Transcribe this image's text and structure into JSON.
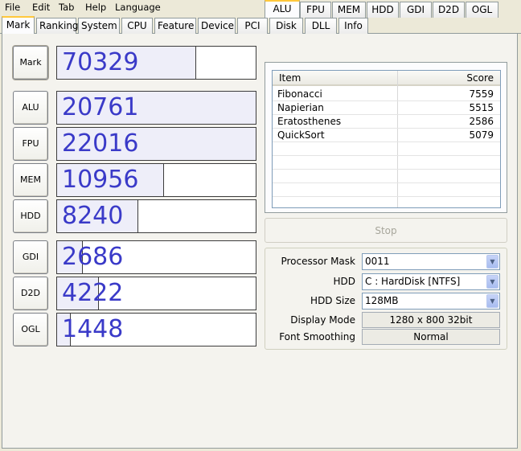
{
  "menu": [
    "File",
    "Edit",
    "Tab",
    "Help",
    "Language"
  ],
  "tabs": [
    "Mark",
    "Ranking",
    "System",
    "CPU",
    "Feature",
    "Device",
    "PCI",
    "Disk",
    "DLL",
    "Info"
  ],
  "active_tab": "Mark",
  "benchmarks": [
    {
      "label": "Mark",
      "score": "70329",
      "fill_fraction": 0.7
    },
    {
      "label": "ALU",
      "score": "20761",
      "fill_fraction": 1.0
    },
    {
      "label": "FPU",
      "score": "22016",
      "fill_fraction": 1.0
    },
    {
      "label": "MEM",
      "score": "10956",
      "fill_fraction": 0.54
    },
    {
      "label": "HDD",
      "score": "8240",
      "fill_fraction": 0.41
    },
    {
      "label": "GDI",
      "score": "2686",
      "fill_fraction": 0.13
    },
    {
      "label": "D2D",
      "score": "4222",
      "fill_fraction": 0.21
    },
    {
      "label": "OGL",
      "score": "1448",
      "fill_fraction": 0.07
    }
  ],
  "sub_tabs": [
    "ALU",
    "FPU",
    "MEM",
    "HDD",
    "GDI",
    "D2D",
    "OGL"
  ],
  "active_sub_tab": "ALU",
  "table": {
    "columns": [
      "Item",
      "Score"
    ],
    "rows": [
      [
        "Fibonacci",
        "7559"
      ],
      [
        "Napierian",
        "5515"
      ],
      [
        "Eratosthenes",
        "2586"
      ],
      [
        "QuickSort",
        "5079"
      ]
    ]
  },
  "stop_label": "Stop",
  "settings": {
    "processor_mask_label": "Processor Mask",
    "processor_mask_value": "0011",
    "hdd_label": "HDD",
    "hdd_value": "C : HardDisk [NTFS]",
    "hdd_size_label": "HDD Size",
    "hdd_size_value": "128MB",
    "display_mode_label": "Display Mode",
    "display_mode_value": "1280 x 800 32bit",
    "font_smoothing_label": "Font Smoothing",
    "font_smoothing_value": "Normal"
  },
  "colors": {
    "score_text": "#3a3ac8",
    "bar_fill": "#eeeef9",
    "active_tab_accent": "#ffc83c",
    "window_bg": "#ece9d8"
  }
}
